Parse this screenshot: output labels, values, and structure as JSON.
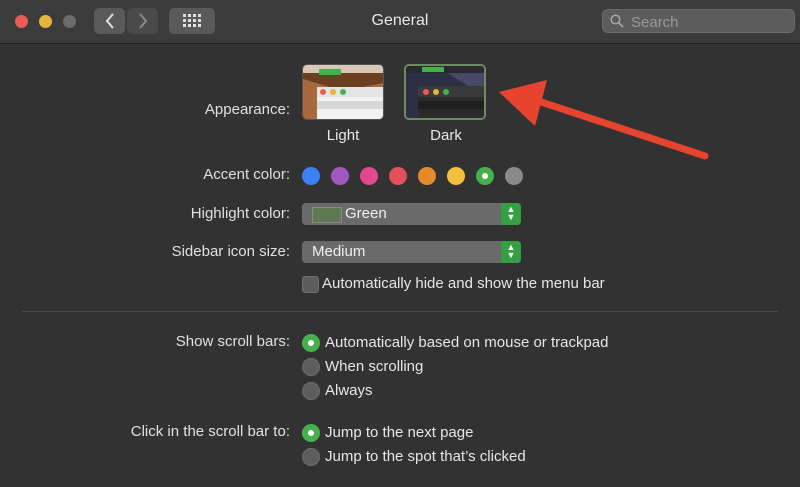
{
  "window": {
    "title": "General"
  },
  "search": {
    "placeholder": "Search"
  },
  "appearance": {
    "label": "Appearance:",
    "options": [
      "Light",
      "Dark"
    ]
  },
  "accent": {
    "label": "Accent color:",
    "colors": [
      "#3b82f6",
      "#a256c4",
      "#e0488f",
      "#e4505a",
      "#e68a2e",
      "#f2bf3b",
      "#46b04f",
      "#8a8a8a"
    ],
    "selected_index": 6
  },
  "highlight": {
    "label": "Highlight color:",
    "value": "Green",
    "swatch": "#5f7a52"
  },
  "sidebar_icon": {
    "label": "Sidebar icon size:",
    "value": "Medium"
  },
  "menubar_checkbox": {
    "label": "Automatically hide and show the menu bar"
  },
  "scroll_bars": {
    "label": "Show scroll bars:",
    "options": [
      "Automatically based on mouse or trackpad",
      "When scrolling",
      "Always"
    ]
  },
  "click_scroll": {
    "label": "Click in the scroll bar to:",
    "options": [
      "Jump to the next page",
      "Jump to the spot that’s clicked"
    ]
  }
}
